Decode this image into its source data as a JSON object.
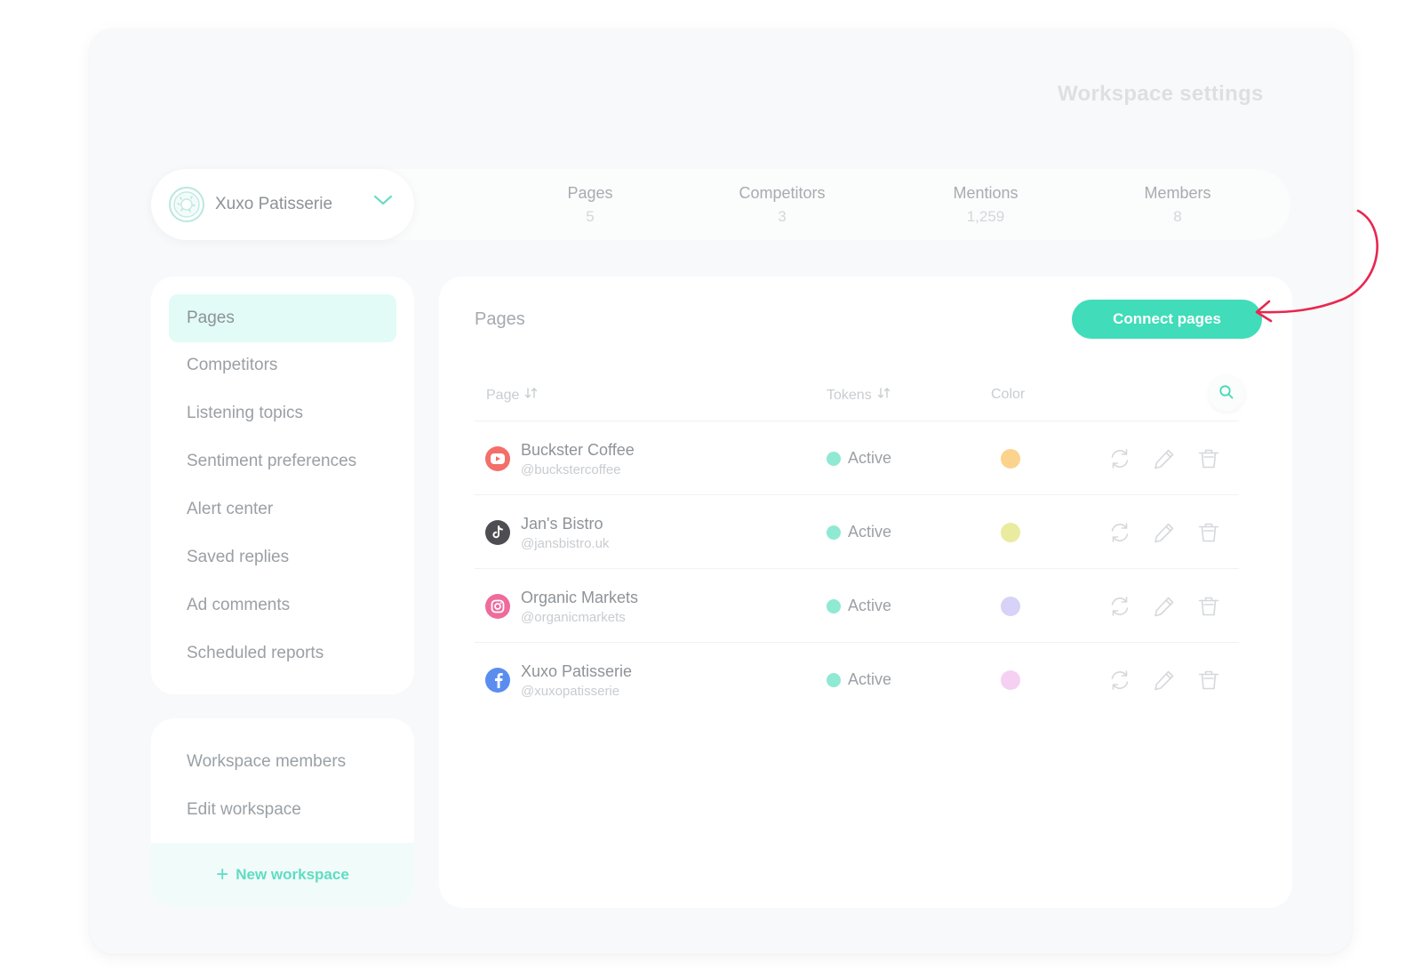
{
  "page_title": "Workspace settings",
  "workspace": {
    "name": "Xuxo Patisserie"
  },
  "stats": [
    {
      "label": "Pages",
      "value": "5"
    },
    {
      "label": "Competitors",
      "value": "3"
    },
    {
      "label": "Mentions",
      "value": "1,259"
    },
    {
      "label": "Members",
      "value": "8"
    }
  ],
  "sidebar": {
    "items": [
      {
        "label": "Pages",
        "active": true
      },
      {
        "label": "Competitors"
      },
      {
        "label": "Listening topics"
      },
      {
        "label": "Sentiment preferences"
      },
      {
        "label": "Alert center"
      },
      {
        "label": "Saved replies"
      },
      {
        "label": "Ad comments"
      },
      {
        "label": "Scheduled reports"
      }
    ],
    "secondary": [
      {
        "label": "Workspace members"
      },
      {
        "label": "Edit workspace"
      }
    ],
    "new_workspace": "New workspace"
  },
  "main": {
    "title": "Pages",
    "connect_label": "Connect pages",
    "columns": {
      "page": "Page",
      "tokens": "Tokens",
      "color": "Color"
    },
    "rows": [
      {
        "name": "Buckster Coffee",
        "handle": "@buckstercoffee",
        "network": "youtube-icon",
        "status": "Active",
        "color": "#fbd38d"
      },
      {
        "name": "Jan's Bistro",
        "handle": "@jansbistro.uk",
        "network": "tiktok-icon",
        "status": "Active",
        "color": "#e9eb9f"
      },
      {
        "name": "Organic Markets",
        "handle": "@organicmarkets",
        "network": "instagram-icon",
        "status": "Active",
        "color": "#d7d2f7"
      },
      {
        "name": "Xuxo Patisserie",
        "handle": "@xuxopatisserie",
        "network": "facebook-icon",
        "status": "Active",
        "color": "#f6d0f3"
      }
    ]
  },
  "colors": {
    "accent": "#41dcb9",
    "status_dot": "#8fe9d3",
    "annotation": "#e8274f"
  }
}
